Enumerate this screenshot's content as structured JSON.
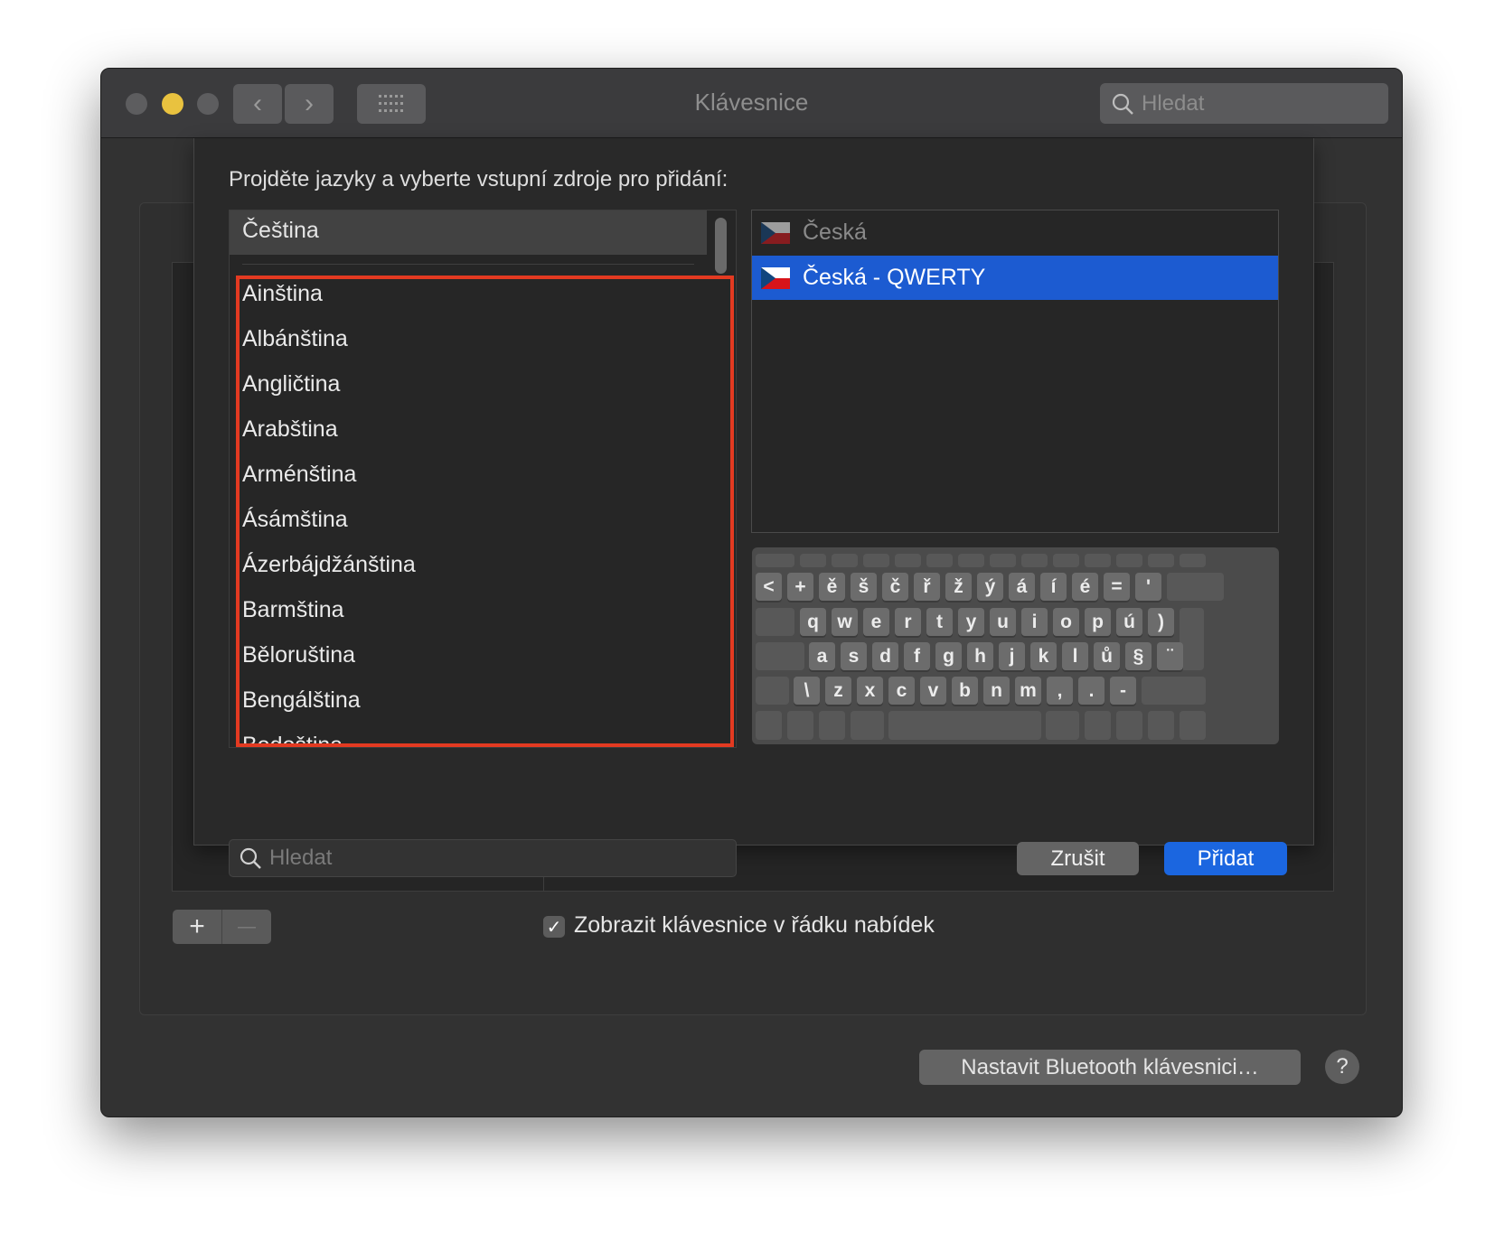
{
  "window": {
    "title": "Klávesnice",
    "search_placeholder": "Hledat",
    "traffic_light_colors": [
      "#5d5d5f",
      "#e9c23f",
      "#5d5d5f"
    ]
  },
  "sheet": {
    "prompt": "Projděte jazyky a vyberte vstupní zdroje pro přidání:",
    "languages_header": "Čeština",
    "languages": [
      "Ainština",
      "Albánština",
      "Angličtina",
      "Arabština",
      "Arménština",
      "Ásámština",
      "Ázerbájdžánština",
      "Barmština",
      "Běloruština",
      "Bengálština",
      "Bodoština"
    ],
    "sources": [
      {
        "label": "Česká",
        "selected": false,
        "icon": "czech-flag-icon"
      },
      {
        "label": "Česká - QWERTY",
        "selected": true,
        "icon": "czech-flag-icon"
      }
    ],
    "keyboard_rows": [
      [
        "<",
        "+",
        "ě",
        "š",
        "č",
        "ř",
        "ž",
        "ý",
        "á",
        "í",
        "é",
        "=",
        "'"
      ],
      [
        "q",
        "w",
        "e",
        "r",
        "t",
        "y",
        "u",
        "i",
        "o",
        "p",
        "ú",
        ")"
      ],
      [
        "a",
        "s",
        "d",
        "f",
        "g",
        "h",
        "j",
        "k",
        "l",
        "ů",
        "§",
        "¨"
      ],
      [
        "\\",
        "z",
        "x",
        "c",
        "v",
        "b",
        "n",
        "m",
        ",",
        ".",
        "-"
      ]
    ],
    "search_placeholder": "Hledat",
    "cancel_label": "Zrušit",
    "add_label": "Přidat",
    "highlight_color": "#e33a21",
    "accent_color": "#1b66e0"
  },
  "footer": {
    "add_symbol": "+",
    "remove_symbol": "—",
    "show_in_menu_bar_label": "Zobrazit klávesnice v řádku nabídek",
    "show_in_menu_bar_checked": true,
    "bluetooth_label": "Nastavit Bluetooth klávesnici…",
    "help_symbol": "?"
  }
}
